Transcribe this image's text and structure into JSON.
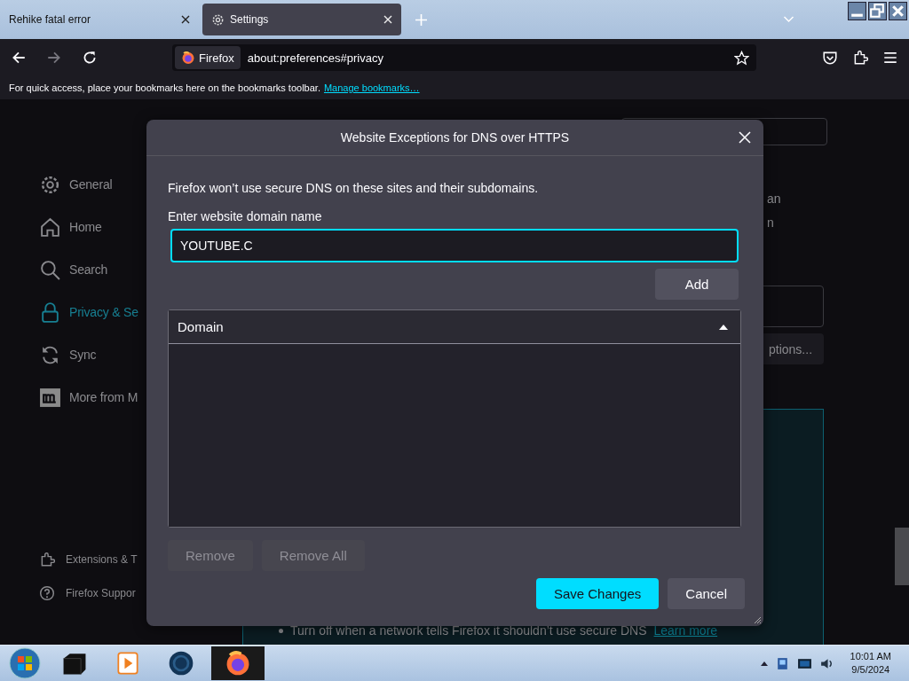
{
  "tabs": [
    {
      "label": "Rehike fatal error",
      "selected": false,
      "kind": "plain"
    },
    {
      "label": "Settings",
      "selected": true,
      "kind": "gear"
    }
  ],
  "nav": {
    "identity": "Firefox",
    "url": "about:preferences#privacy"
  },
  "bookmarks_bar": {
    "message": "For quick access, place your bookmarks here on the bookmarks toolbar.",
    "link": "Manage bookmarks…"
  },
  "sidebar": {
    "items": [
      {
        "label": "General",
        "kind": "gear",
        "selected": false
      },
      {
        "label": "Home",
        "kind": "home",
        "selected": false
      },
      {
        "label": "Search",
        "kind": "search",
        "selected": false
      },
      {
        "label": "Privacy & Se",
        "kind": "lock",
        "selected": true
      },
      {
        "label": "Sync",
        "kind": "sync",
        "selected": false
      },
      {
        "label": "More from M",
        "kind": "m",
        "selected": false
      }
    ],
    "footer": [
      {
        "label": "Extensions & T",
        "kind": "puzzle"
      },
      {
        "label": "Firefox Suppor",
        "kind": "help"
      }
    ]
  },
  "background": {
    "fragment_1": "an",
    "fragment_2": "n",
    "button_fragment": "ptions...",
    "bullet": "Turn off when a network tells Firefox it shouldn’t use secure DNS",
    "link": "Learn more"
  },
  "dialog": {
    "title": "Website Exceptions for DNS over HTTPS",
    "description": "Firefox won’t use secure DNS on these sites and their subdomains.",
    "field_label": "Enter website domain name",
    "input": {
      "value": "YOUTUBE.C",
      "focused": true
    },
    "add_button": "Add",
    "table": {
      "column": "Domain",
      "sort_ascending": true
    },
    "list_buttons": [
      {
        "label": "Remove",
        "disabled": true
      },
      {
        "label": "Remove All",
        "disabled": true
      }
    ],
    "footer_buttons": [
      {
        "label": "Save Changes",
        "kind": "primary"
      },
      {
        "label": "Cancel",
        "kind": "secondary"
      }
    ]
  },
  "taskbar": {
    "time": "10:01 AM",
    "date": "9/5/2024"
  }
}
